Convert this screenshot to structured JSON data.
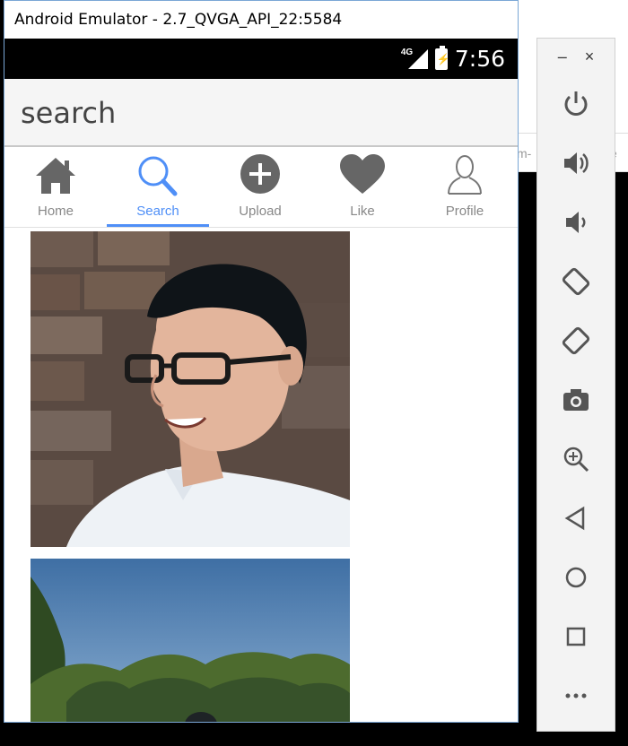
{
  "window": {
    "title": "Android Emulator - 2.7_QVGA_API_22:5584"
  },
  "status_bar": {
    "network": "4G",
    "time": "7:56"
  },
  "search": {
    "text": "search"
  },
  "tabs": [
    {
      "label": "Home",
      "icon": "home-icon"
    },
    {
      "label": "Search",
      "icon": "search-icon",
      "active": true
    },
    {
      "label": "Upload",
      "icon": "upload-icon"
    },
    {
      "label": "Like",
      "icon": "heart-icon"
    },
    {
      "label": "Profile",
      "icon": "profile-icon"
    }
  ],
  "colors": {
    "accent": "#4f8ff7",
    "icon_gray": "#666666"
  },
  "toolbar": {
    "window_controls": [
      "–",
      "×"
    ],
    "buttons": [
      "power-icon",
      "volume-up-icon",
      "volume-down-icon",
      "rotate-left-icon",
      "rotate-right-icon",
      "camera-icon",
      "zoom-icon",
      "back-icon",
      "home-circle-icon",
      "overview-icon",
      "more-icon"
    ]
  },
  "desktop": {
    "right_fragment": "m-",
    "right_fragment2": "e"
  }
}
